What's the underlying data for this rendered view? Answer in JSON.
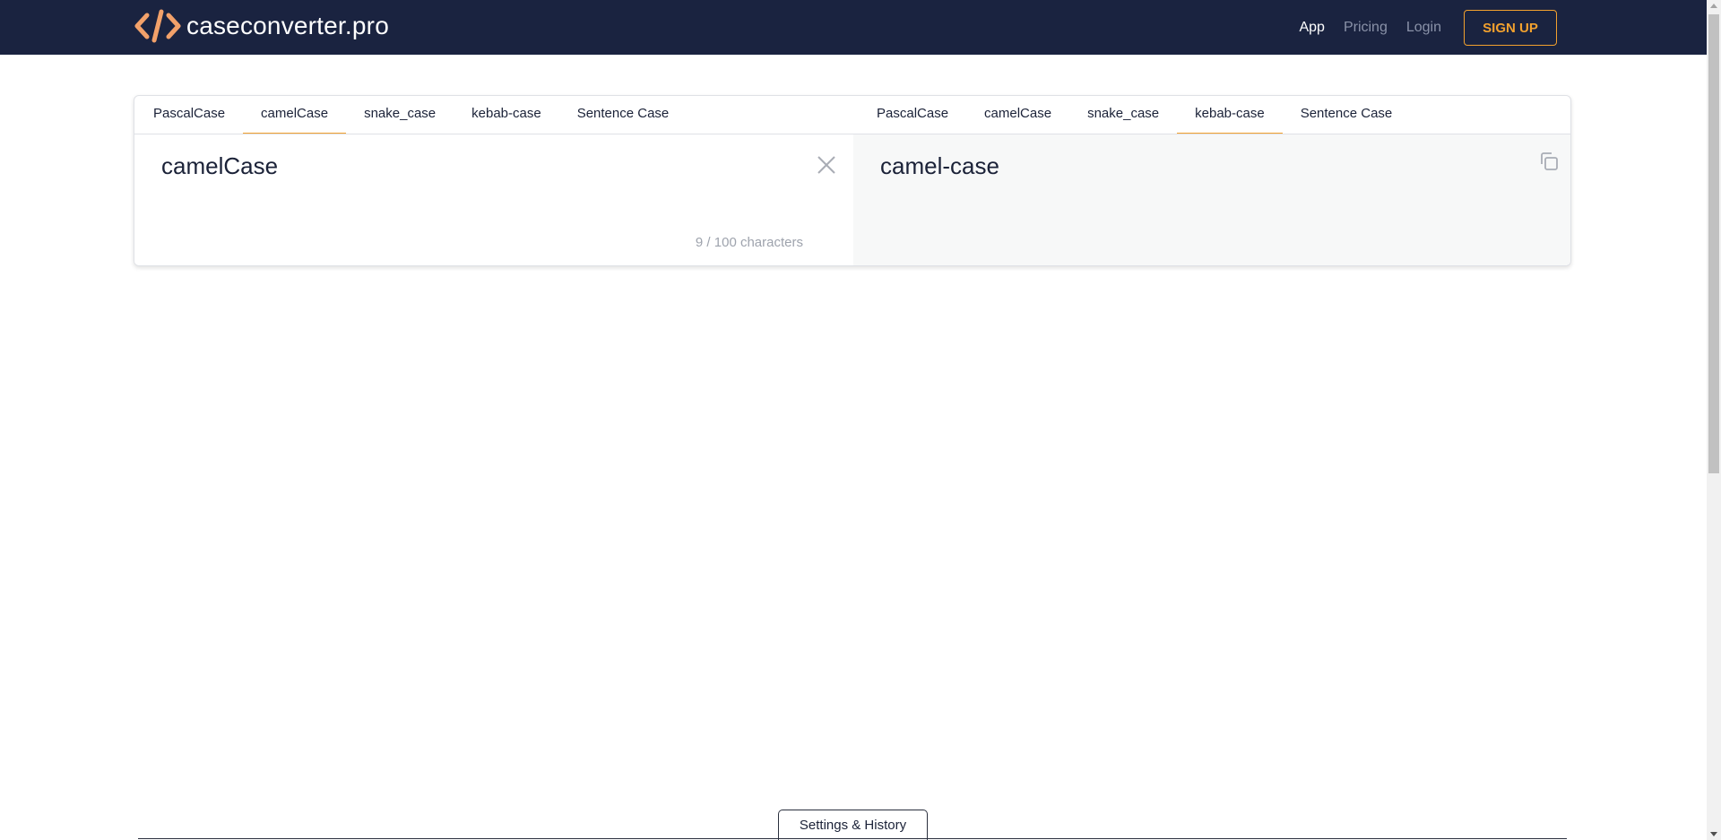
{
  "brand": {
    "name": "caseconverter.pro",
    "logo_icon": "code-brackets-icon",
    "accent": "#f2a12e",
    "navbar_bg": "#1a2340"
  },
  "nav": {
    "app": "App",
    "pricing": "Pricing",
    "login": "Login",
    "signup": "SIGN UP"
  },
  "input_tabs": [
    "PascalCase",
    "camelCase",
    "snake_case",
    "kebab-case",
    "Sentence Case"
  ],
  "input_active_tab": "camelCase",
  "output_tabs": [
    "PascalCase",
    "camelCase",
    "snake_case",
    "kebab-case",
    "Sentence Case"
  ],
  "output_active_tab": "kebab-case",
  "input": {
    "value": "camelCase",
    "char_count": "9 / 100 characters",
    "clear_icon": "close-icon"
  },
  "output": {
    "value": "camel-case",
    "copy_icon": "copy-icon"
  },
  "footer": {
    "settings_tab": "Settings & History"
  }
}
